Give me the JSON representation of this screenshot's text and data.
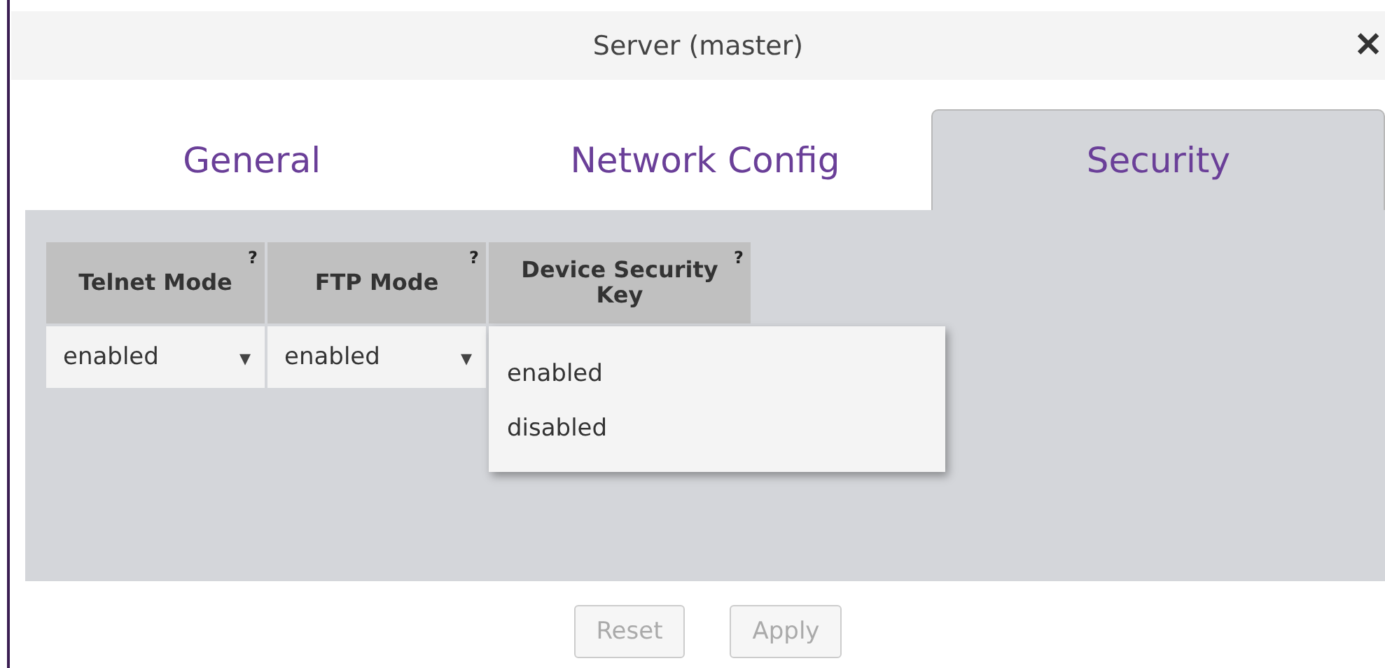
{
  "window": {
    "title": "Server (master)",
    "close": "✕"
  },
  "tabs": [
    {
      "label": "General",
      "selected": false
    },
    {
      "label": "Network Config",
      "selected": false
    },
    {
      "label": "Security",
      "selected": true
    }
  ],
  "table": {
    "columns": [
      {
        "label": "Telnet Mode",
        "help": "?",
        "value": "enabled",
        "arrow": "▾"
      },
      {
        "label": "FTP Mode",
        "help": "?",
        "value": "enabled",
        "arrow": "▾"
      },
      {
        "label": "Device Security Key",
        "help": "?"
      }
    ],
    "dropdown": {
      "options": [
        "enabled",
        "disabled"
      ]
    }
  },
  "buttons": [
    {
      "label": "Reset",
      "disabled": true
    },
    {
      "label": "Apply",
      "disabled": true
    }
  ]
}
